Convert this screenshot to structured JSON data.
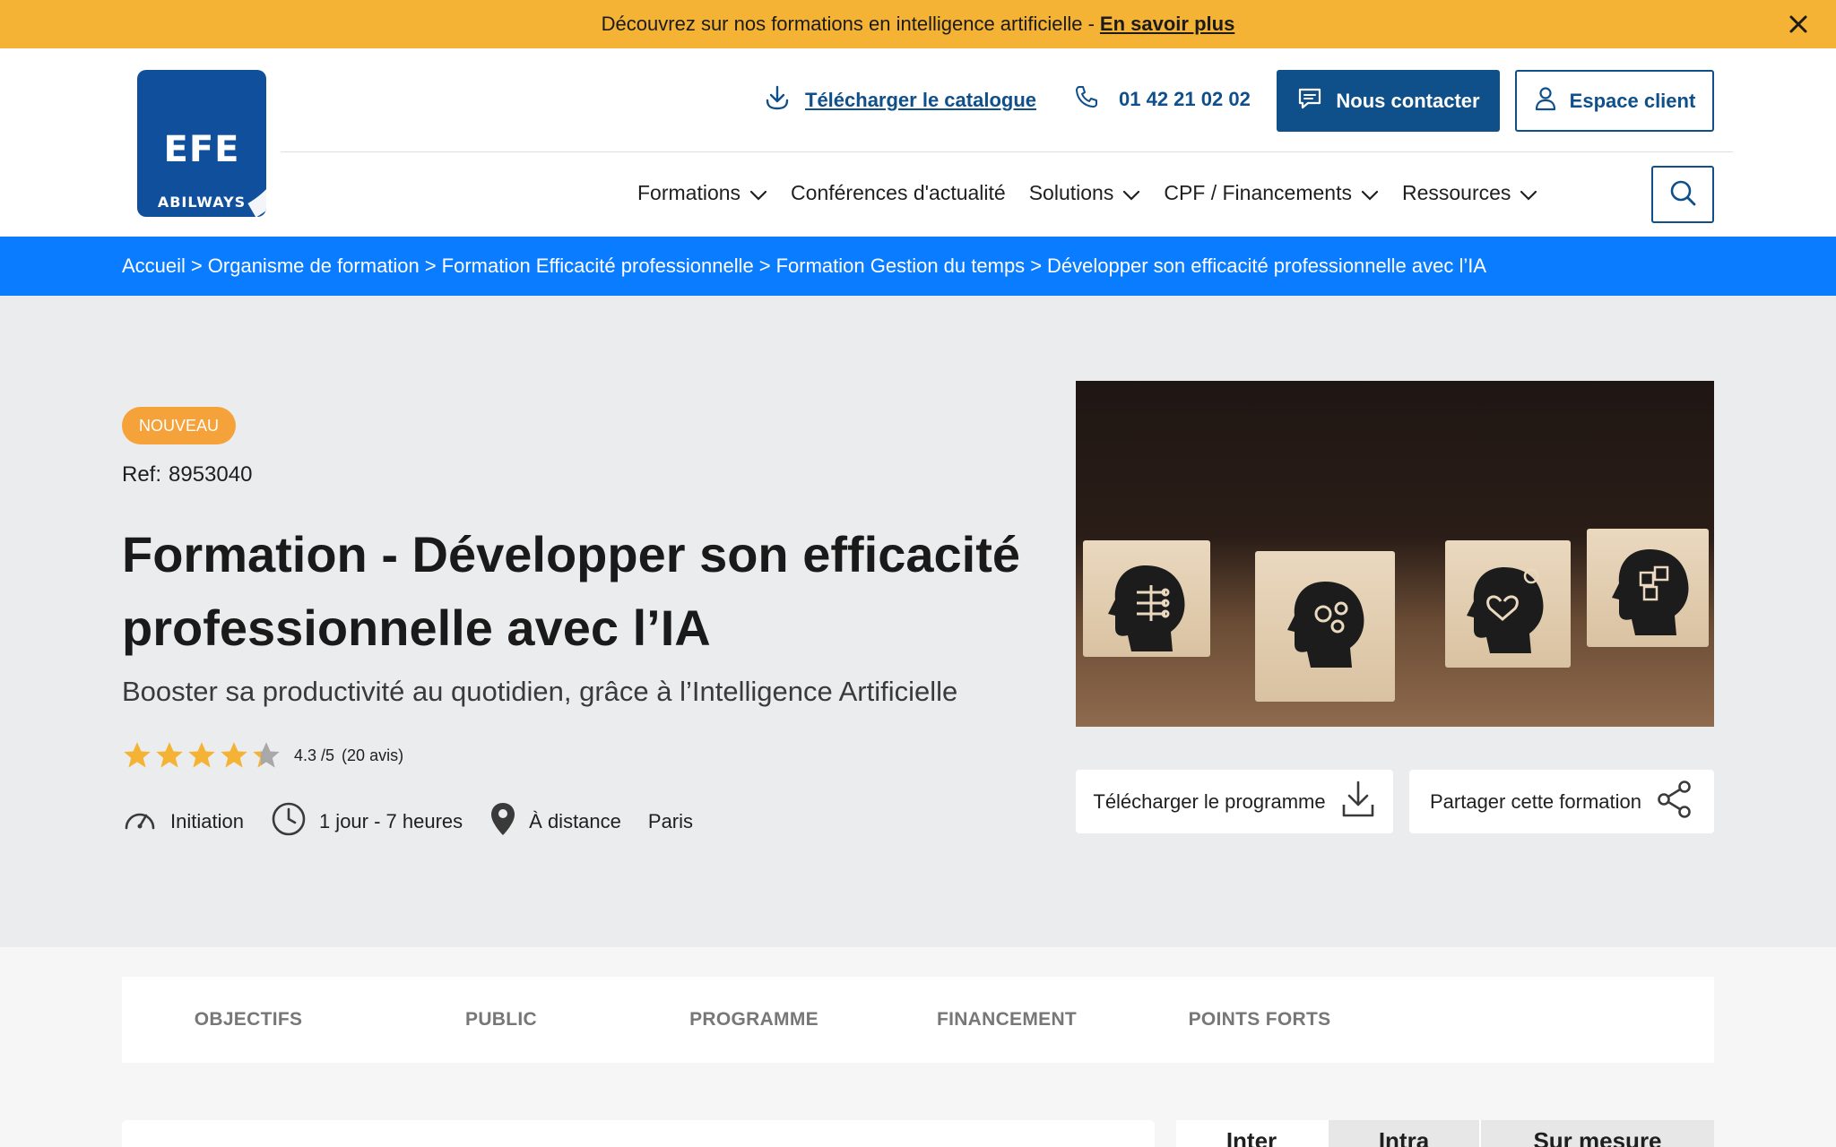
{
  "banner": {
    "text": "Découvrez sur nos formations en intelligence artificielle -",
    "link": "En savoir plus",
    "close_icon": "close-icon"
  },
  "header": {
    "logo": {
      "top": "EFE",
      "bottom": "ABILWAYS"
    },
    "catalog_label": "Télécharger le catalogue",
    "phone": "01 42 21 02 02",
    "contact_label": "Nous contacter",
    "client_label": "Espace client",
    "nav": [
      {
        "label": "Formations",
        "has_dropdown": true
      },
      {
        "label": "Conférences d'actualité",
        "has_dropdown": false
      },
      {
        "label": "Solutions",
        "has_dropdown": true
      },
      {
        "label": "CPF / Financements",
        "has_dropdown": true
      },
      {
        "label": "Ressources",
        "has_dropdown": true
      }
    ]
  },
  "breadcrumb": [
    "Accueil",
    "Organisme de formation",
    "Formation Efficacité professionnelle",
    "Formation Gestion du temps",
    "Développer son efficacité professionnelle avec l’IA"
  ],
  "breadcrumb_separator": ">",
  "hero": {
    "badge": "NOUVEAU",
    "ref_label": "Ref:",
    "ref_value": "8953040",
    "title": "Formation - Développer son efficacité professionnelle avec l’IA",
    "subtitle": "Booster sa productivité au quotidien, grâce à l’Intelligence Artificielle",
    "rating": {
      "score": 4.3,
      "score_text": "4.3 /5",
      "reviews_text": "(20 avis)",
      "max": 5
    },
    "level": "Initiation",
    "duration": "1 jour - 7 heures",
    "location_mode": "À distance",
    "location_city": "Paris",
    "download_program": "Télécharger le programme",
    "share": "Partager cette formation"
  },
  "section_tabs": [
    "OBJECTIFS",
    "PUBLIC",
    "PROGRAMME",
    "FINANCEMENT",
    "POINTS FORTS"
  ],
  "mode_tabs": [
    "Inter",
    "Intra",
    "Sur mesure"
  ],
  "colors": {
    "banner": "#f5b335",
    "brand": "#0f4f8a",
    "breadcrumb_bg": "#0a7cff",
    "badge": "#f5a23a",
    "star": "#f5b335"
  }
}
